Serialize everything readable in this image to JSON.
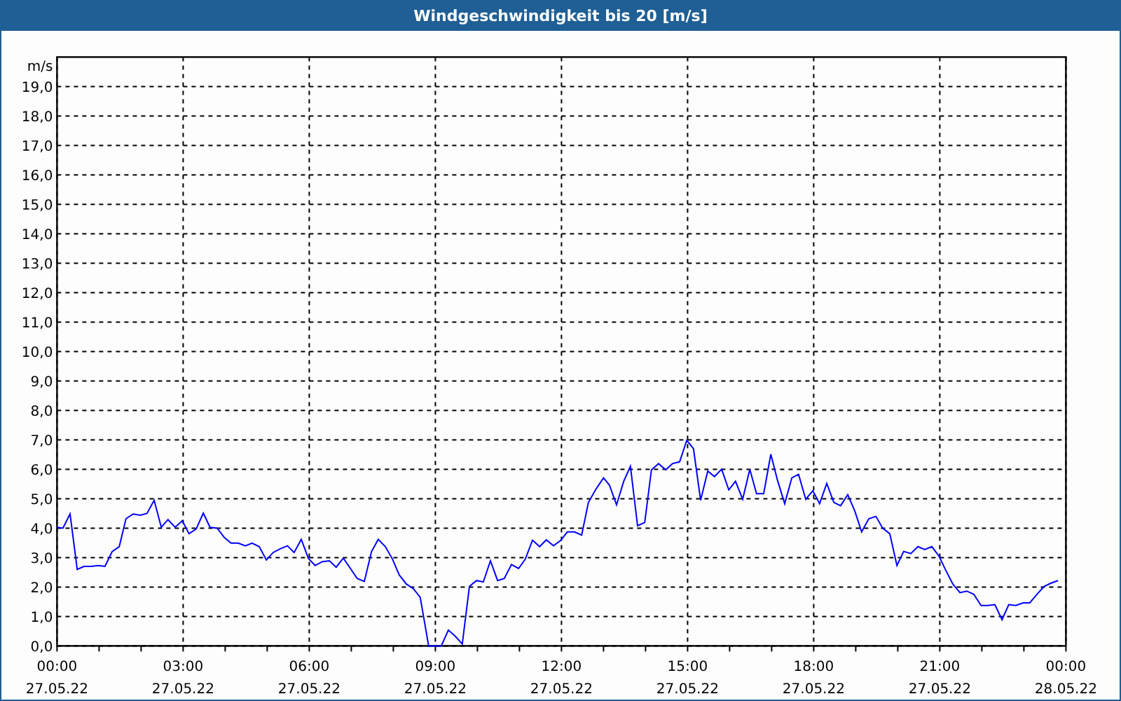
{
  "window": {
    "title": "Windgeschwindigkeit bis 20 [m/s]"
  },
  "chart": {
    "chart_data": {
      "type": "line",
      "grid": true,
      "ylabel": "m/s",
      "xlim": [
        0,
        24
      ],
      "ylim": [
        0,
        20
      ],
      "x": [
        0,
        0.14,
        0.31,
        0.48,
        0.64,
        0.81,
        0.98,
        1.14,
        1.31,
        1.48,
        1.64,
        1.81,
        1.98,
        2.14,
        2.31,
        2.48,
        2.64,
        2.81,
        2.98,
        3.14,
        3.31,
        3.48,
        3.64,
        3.81,
        3.98,
        4.14,
        4.31,
        4.48,
        4.64,
        4.81,
        4.98,
        5.14,
        5.31,
        5.48,
        5.64,
        5.81,
        5.98,
        6.14,
        6.31,
        6.48,
        6.64,
        6.81,
        6.98,
        7.14,
        7.31,
        7.48,
        7.64,
        7.81,
        7.98,
        8.14,
        8.31,
        8.48,
        8.64,
        8.84,
        9.0,
        9.14,
        9.31,
        9.48,
        9.64,
        9.81,
        9.98,
        10.14,
        10.31,
        10.48,
        10.64,
        10.81,
        10.98,
        11.14,
        11.31,
        11.48,
        11.64,
        11.81,
        11.98,
        12.14,
        12.31,
        12.48,
        12.64,
        12.81,
        13.0,
        13.14,
        13.31,
        13.48,
        13.64,
        13.81,
        13.98,
        14.14,
        14.31,
        14.48,
        14.64,
        14.81,
        14.98,
        15.14,
        15.31,
        15.48,
        15.64,
        15.81,
        15.98,
        16.14,
        16.31,
        16.48,
        16.64,
        16.81,
        16.98,
        17.14,
        17.31,
        17.48,
        17.64,
        17.81,
        17.98,
        18.14,
        18.31,
        18.48,
        18.64,
        18.81,
        18.98,
        19.14,
        19.31,
        19.48,
        19.64,
        19.81,
        19.98,
        20.14,
        20.31,
        20.48,
        20.64,
        20.81,
        20.98,
        21.14,
        21.31,
        21.48,
        21.64,
        21.81,
        21.98,
        22.14,
        22.31,
        22.48,
        22.64,
        22.81,
        22.98,
        23.14,
        23.31,
        23.48,
        23.64,
        23.81
      ],
      "series": [
        {
          "color": "#0000ff",
          "values": [
            4.03,
            4.0,
            4.48,
            2.6,
            2.7,
            2.7,
            2.73,
            2.7,
            3.2,
            3.37,
            4.32,
            4.48,
            4.44,
            4.5,
            4.95,
            4.03,
            4.29,
            4.03,
            4.25,
            3.81,
            3.97,
            4.51,
            4.03,
            4.0,
            3.68,
            3.49,
            3.49,
            3.4,
            3.49,
            3.37,
            2.92,
            3.17,
            3.3,
            3.4,
            3.17,
            3.62,
            2.97,
            2.73,
            2.86,
            2.89,
            2.67,
            2.98,
            2.63,
            2.29,
            2.19,
            3.2,
            3.62,
            3.37,
            2.95,
            2.41,
            2.1,
            1.94,
            1.65,
            0,
            0,
            0,
            0.54,
            0.32,
            0.06,
            2.02,
            2.22,
            2.17,
            2.89,
            2.22,
            2.29,
            2.76,
            2.63,
            2.95,
            3.59,
            3.37,
            3.6,
            3.4,
            3.58,
            3.87,
            3.87,
            3.76,
            4.87,
            5.3,
            5.71,
            5.46,
            4.79,
            5.59,
            6.1,
            4.08,
            4.19,
            5.98,
            6.19,
            5.98,
            6.19,
            6.25,
            6.98,
            6.7,
            4.95,
            5.94,
            5.75,
            6.0,
            5.3,
            5.59,
            4.98,
            6.0,
            5.17,
            5.17,
            6.51,
            5.62,
            4.83,
            5.71,
            5.83,
            4.98,
            5.27,
            4.83,
            5.52,
            4.87,
            4.76,
            5.14,
            4.57,
            3.87,
            4.32,
            4.4,
            4.0,
            3.81,
            2.73,
            3.21,
            3.14,
            3.37,
            3.27,
            3.37,
            3.05,
            2.57,
            2.1,
            1.81,
            1.86,
            1.75,
            1.37,
            1.37,
            1.4,
            0.89,
            1.4,
            1.37,
            1.46,
            1.46,
            1.75,
            2.02,
            2.13,
            2.22
          ]
        }
      ],
      "xticks": [
        {
          "value": 0,
          "label": "00:00"
        },
        {
          "value": 3,
          "label": "03:00"
        },
        {
          "value": 6,
          "label": "06:00"
        },
        {
          "value": 9,
          "label": "09:00"
        },
        {
          "value": 12,
          "label": "12:00"
        },
        {
          "value": 15,
          "label": "15:00"
        },
        {
          "value": 18,
          "label": "18:00"
        },
        {
          "value": 21,
          "label": "21:00"
        },
        {
          "value": 24,
          "label": "00:00"
        }
      ],
      "yticks": [
        {
          "value": 0,
          "label": "0,0"
        },
        {
          "value": 1,
          "label": "1,0"
        },
        {
          "value": 2,
          "label": "2,0"
        },
        {
          "value": 3,
          "label": "3,0"
        },
        {
          "value": 4,
          "label": "4,0"
        },
        {
          "value": 5,
          "label": "5,0"
        },
        {
          "value": 6,
          "label": "6,0"
        },
        {
          "value": 7,
          "label": "7,0"
        },
        {
          "value": 8,
          "label": "8,0"
        },
        {
          "value": 9,
          "label": "9,0"
        },
        {
          "value": 10,
          "label": "10,0"
        },
        {
          "value": 11,
          "label": "11,0"
        },
        {
          "value": 12,
          "label": "12,0"
        },
        {
          "value": 13,
          "label": "13,0"
        },
        {
          "value": 14,
          "label": "14,0"
        },
        {
          "value": 15,
          "label": "15,0"
        },
        {
          "value": 16,
          "label": "16,0"
        },
        {
          "value": 17,
          "label": "17,0"
        },
        {
          "value": 18,
          "label": "18,0"
        },
        {
          "value": 19,
          "label": "19,0"
        }
      ]
    },
    "x_dates": [
      "27.05.22",
      "27.05.22",
      "27.05.22",
      "27.05.22",
      "27.05.22",
      "27.05.22",
      "27.05.22",
      "27.05.22",
      "28.05.22"
    ]
  }
}
